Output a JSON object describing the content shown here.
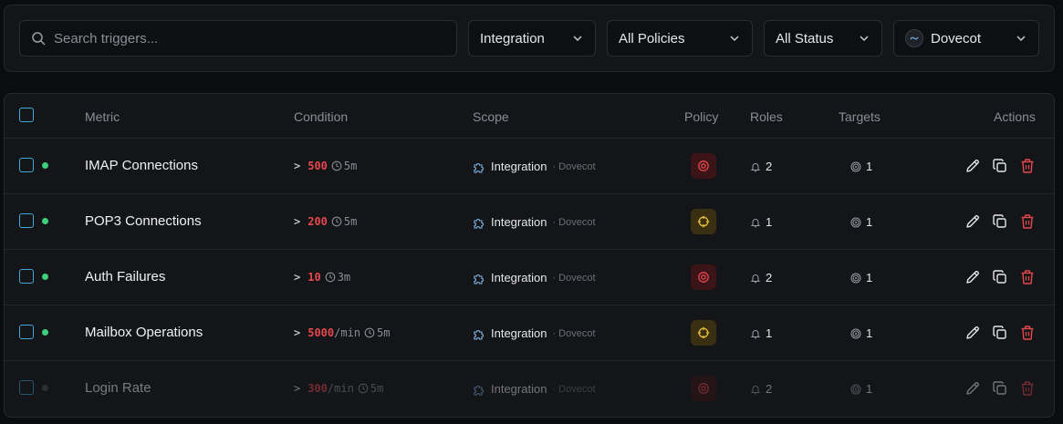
{
  "filters": {
    "search_placeholder": "Search triggers...",
    "type": "Integration",
    "policies": "All Policies",
    "status": "All Status",
    "integration": "Dovecot"
  },
  "columns": {
    "metric": "Metric",
    "condition": "Condition",
    "scope": "Scope",
    "policy": "Policy",
    "roles": "Roles",
    "targets": "Targets",
    "actions": "Actions"
  },
  "rows": [
    {
      "metric": "IMAP Connections",
      "op": ">",
      "value": "500",
      "unit": "",
      "duration": "5m",
      "scope": "Integration",
      "scope_sub": "· Dovecot",
      "policy": "critical",
      "roles": "2",
      "targets": "1",
      "enabled": true
    },
    {
      "metric": "POP3 Connections",
      "op": ">",
      "value": "200",
      "unit": "",
      "duration": "5m",
      "scope": "Integration",
      "scope_sub": "· Dovecot",
      "policy": "warning",
      "roles": "1",
      "targets": "1",
      "enabled": true
    },
    {
      "metric": "Auth Failures",
      "op": ">",
      "value": "10",
      "unit": "",
      "duration": "3m",
      "scope": "Integration",
      "scope_sub": "· Dovecot",
      "policy": "critical",
      "roles": "2",
      "targets": "1",
      "enabled": true
    },
    {
      "metric": "Mailbox Operations",
      "op": ">",
      "value": "5000",
      "unit": "/min",
      "duration": "5m",
      "scope": "Integration",
      "scope_sub": "· Dovecot",
      "policy": "warning",
      "roles": "1",
      "targets": "1",
      "enabled": true
    },
    {
      "metric": "Login Rate",
      "op": ">",
      "value": "300",
      "unit": "/min",
      "duration": "5m",
      "scope": "Integration",
      "scope_sub": "· Dovecot",
      "policy": "critical",
      "roles": "2",
      "targets": "1",
      "enabled": false
    }
  ],
  "colors": {
    "accent": "#3fa7d6",
    "critical": "#e5484d",
    "warning": "#e2b93b",
    "active_dot": "#3ecf7a",
    "inactive_dot": "#4a4d55"
  }
}
